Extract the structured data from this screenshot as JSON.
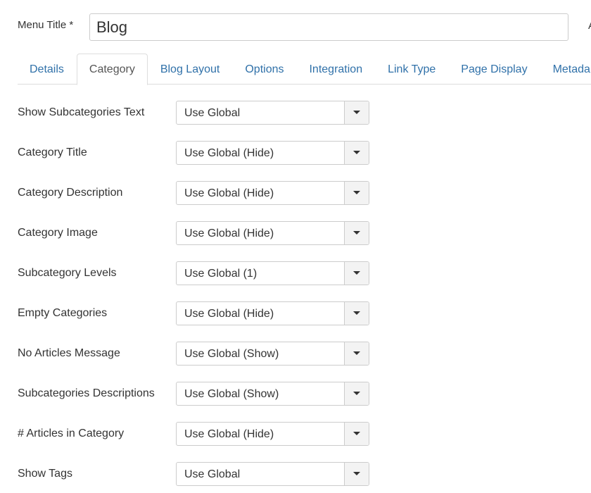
{
  "menu_title": {
    "label": "Menu Title *",
    "value": "Blog",
    "overflow_label": "A"
  },
  "tabs": [
    {
      "label": "Details",
      "active": false
    },
    {
      "label": "Category",
      "active": true
    },
    {
      "label": "Blog Layout",
      "active": false
    },
    {
      "label": "Options",
      "active": false
    },
    {
      "label": "Integration",
      "active": false
    },
    {
      "label": "Link Type",
      "active": false
    },
    {
      "label": "Page Display",
      "active": false
    },
    {
      "label": "Metada",
      "active": false
    }
  ],
  "fields": [
    {
      "label": "Show Subcategories Text",
      "value": "Use Global"
    },
    {
      "label": "Category Title",
      "value": "Use Global (Hide)"
    },
    {
      "label": "Category Description",
      "value": "Use Global (Hide)"
    },
    {
      "label": "Category Image",
      "value": "Use Global (Hide)"
    },
    {
      "label": "Subcategory Levels",
      "value": "Use Global (1)"
    },
    {
      "label": "Empty Categories",
      "value": "Use Global (Hide)"
    },
    {
      "label": "No Articles Message",
      "value": "Use Global (Show)"
    },
    {
      "label": "Subcategories Descriptions",
      "value": "Use Global (Show)"
    },
    {
      "label": "# Articles in Category",
      "value": "Use Global (Hide)"
    },
    {
      "label": "Show Tags",
      "value": "Use Global"
    }
  ],
  "colors": {
    "tab_link": "#3071a9",
    "tab_active_text": "#555555",
    "border": "#cccccc"
  }
}
